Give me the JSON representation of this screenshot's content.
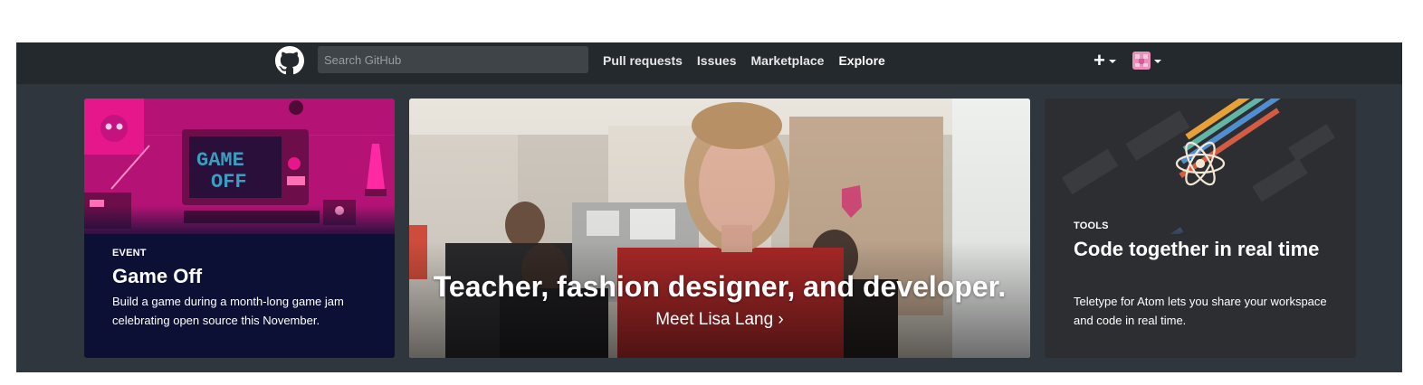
{
  "header": {
    "search_placeholder": "Search GitHub",
    "nav": [
      {
        "label": "Pull requests"
      },
      {
        "label": "Issues"
      },
      {
        "label": "Marketplace"
      },
      {
        "label": "Explore",
        "active": true
      }
    ],
    "create_icon": "plus-icon",
    "logo_icon": "github-octocat-icon"
  },
  "cards": {
    "left": {
      "kicker": "EVENT",
      "title": "Game Off",
      "description": "Build a game during a month-long game jam celebrating open source this November.",
      "art_text": [
        "GAME",
        "OFF"
      ]
    },
    "middle": {
      "headline": "Teacher, fashion designer, and developer.",
      "link": "Meet Lisa Lang ›"
    },
    "right": {
      "kicker": "TOOLS",
      "title": "Code together in real time",
      "description": "Teletype for Atom lets you share your workspace and code in real time.",
      "icon": "atom-icon"
    }
  },
  "colors": {
    "header_bg": "#24292e",
    "frame_bg": "#2f363d",
    "game_off_pink": "#e6168b",
    "game_off_navy": "#0c1035"
  }
}
